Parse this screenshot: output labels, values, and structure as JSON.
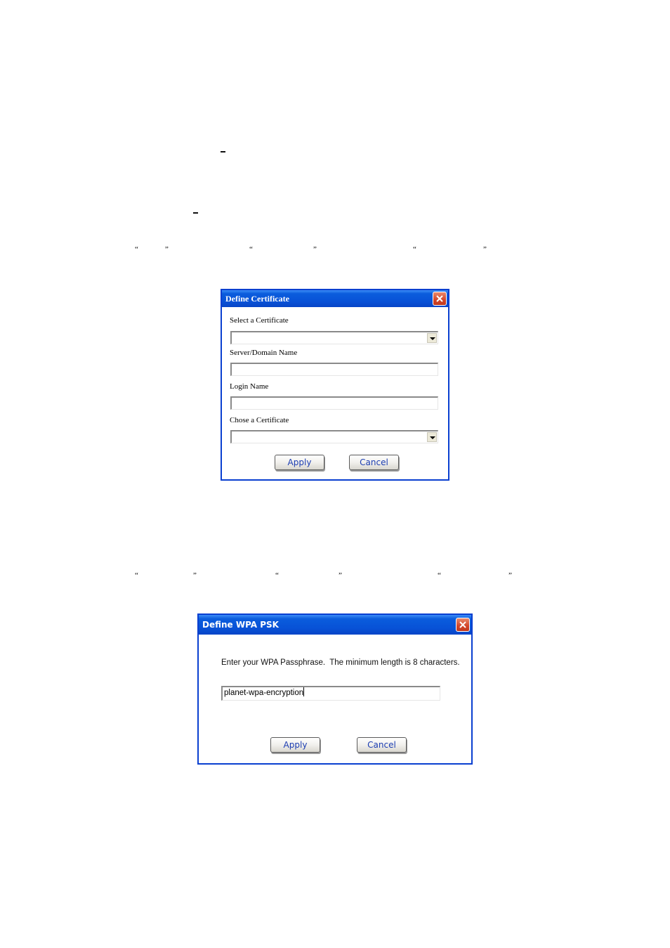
{
  "page": {
    "marks": {
      "dash_1": "–",
      "dash_2": "–",
      "quote_open": "“",
      "quote_close": "”"
    }
  },
  "certificate_dialog": {
    "title": "Define Certificate",
    "close_icon": "close-x-icon",
    "fields": [
      {
        "label": "Select a Certificate",
        "type": "dropdown",
        "value": ""
      },
      {
        "label": "Server/Domain Name",
        "type": "text",
        "value": ""
      },
      {
        "label": "Login Name",
        "type": "text",
        "value": ""
      },
      {
        "label": "Chose a Certificate",
        "type": "dropdown",
        "value": ""
      }
    ],
    "apply_label": "Apply",
    "cancel_label": "Cancel"
  },
  "wpa_dialog": {
    "title": "Define WPA PSK",
    "close_icon": "close-x-icon",
    "instruction": "Enter your WPA Passphrase.  The minimum length is 8 characters.",
    "passphrase_value": "planet-wpa-encryption",
    "apply_label": "Apply",
    "cancel_label": "Cancel"
  }
}
